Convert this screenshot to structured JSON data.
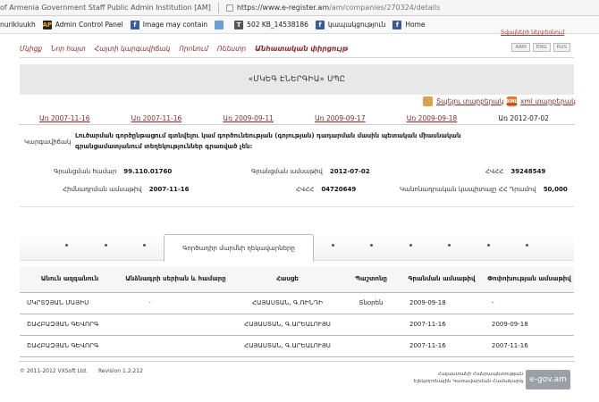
{
  "browser": {
    "tab_title": "of Armenia Government Staff Public Admin Institution [AM]",
    "url_main": "https://www.e-register.am",
    "url_path": "/am/companies/270324/details"
  },
  "bookmarks": [
    {
      "label": "nurikluukh",
      "icon": "doc-icon"
    },
    {
      "label": "Admin Control Panel",
      "icon": "ap-icon"
    },
    {
      "label": "Image may contain",
      "icon": "facebook-icon"
    },
    {
      "label": "",
      "icon": "image-icon"
    },
    {
      "label": "502 KB_14538186",
      "icon": "t-icon"
    },
    {
      "label": "կապակցություն",
      "icon": "facebook-icon"
    },
    {
      "label": "Home",
      "icon": "facebook-icon"
    }
  ],
  "top_link": "Տվյալների ներբեռնում",
  "nav": {
    "items": [
      "Մկիցք",
      "Նոր հայտ",
      "Հայտի կարգավիճակ",
      "Որոնում",
      "Ռեեստր",
      "Անհատական փիրցույթ"
    ],
    "langs": [
      "ARM",
      "ENG",
      "RUS"
    ]
  },
  "company_title": "«ՄԿԵԳ ԷՆԵՐԳԻԱ» ՍՊԸ",
  "downloads": {
    "print": "Տպելու տարբերակ",
    "xml": "xml տարբերակ",
    "xml_icon_text": "XML"
  },
  "dates": {
    "links": [
      "Առ 2007-11-16",
      "Առ 2007-11-16",
      "Առ 2009-09-11",
      "Առ 2009-09-17",
      "Առ 2009-09-18"
    ],
    "current": "Առ 2012-07-02"
  },
  "status": {
    "label": "Կարգավիճակ",
    "text": "Լուծարման գործընթացում գտնվելու կամ գործունեության (գոյության) դադարման մասին պետական միասնական գրանցամատյանում տեղեկություններ գրառված չեն:"
  },
  "details": {
    "reg_number_label": "Գրանցման համար",
    "reg_number": "99.110.01760",
    "reg_date_label": "Գրանցման ամսաթիվ",
    "reg_date": "2012-07-02",
    "tin_label": "ՀՎՀՀ",
    "tin": "39248549",
    "founding_date_label": "Հիմնադրման ամսաթիվ",
    "founding_date": "2007-11-16",
    "hvhh_label": "ՀՎՀՀ",
    "hvhh": "04720649",
    "capital_label": "Կանոնադրական կապիտալը ՀՀ Դրամով",
    "capital": "50,000"
  },
  "active_tab": "Գործադիր մարմնի ղեկավարները",
  "table": {
    "headers": [
      "Անուն ազգանուն",
      "Անձնագրի սերիան և համարը",
      "Հասցե",
      "Պաշտոնը",
      "Գրանման ամսաթիվ",
      "Փոփոխության ամսաթիվ"
    ],
    "rows": [
      [
        "ՄԿՐՏՉՅԱՆ ՄԱՅԻՍ",
        "·",
        "ՀԱՅԱՍՏԱՆ, Գ.ՌԻՆԴԻ",
        "Տնօրեն",
        "2009-09-18",
        "-"
      ],
      [
        "ՇԱՀԲԱԶՅԱՆ ԳԵՎՈՐԳ",
        "",
        "ՀԱՅԱՍՏԱՆ, Գ.ԱՐԵԱԼՈՒՅՍ",
        "",
        "2007-11-16",
        "2009-09-18"
      ],
      [
        "ՇԱՀԲԱԶՅԱՆ ԳԵՎՈՐԳ",
        "",
        "ՀԱՅԱՍՏԱՆ, Գ.ԱՐԵԱԼՈՒՅՍ",
        "",
        "2007-11-16",
        "2007-11-16"
      ]
    ]
  },
  "footer": {
    "copyright": "© 2011-2012 VXSoft Ltd.",
    "revision": "Revision 1.2.212",
    "ministry_line1": "Հայաստանի Հանրապետության",
    "ministry_line2": "Էլեկտրոնային Կառավարման Համակարգ",
    "egov": "e-gov.am"
  }
}
